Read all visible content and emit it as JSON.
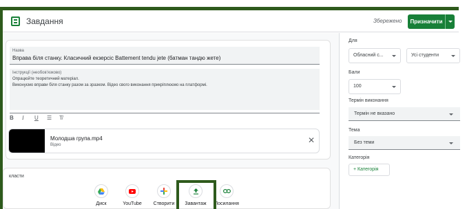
{
  "header": {
    "title": "Завдання",
    "saved": "Збережено",
    "assign_label": "Призначити"
  },
  "title_field": {
    "label": "Назва",
    "value": "Вправа біля станку. Класичний екзерсіс Battement tendu jete (батман тандю жете)"
  },
  "description_field": {
    "label": "Інструкції (необов'язково)",
    "lines": [
      "Опрацюйте теоретичний матеріал.",
      "Виконуємо вправи біля станку разом за зразком. Відео свого виконання прикріплюємо на платформі."
    ]
  },
  "format": {
    "bold": "B",
    "italic": "I",
    "underline": "U",
    "list": "☰",
    "clear": "T̸"
  },
  "attachment": {
    "name": "Молодша група.mp4",
    "type": "Відео"
  },
  "attach_section": {
    "title": "класти",
    "tools": [
      {
        "label": "Диск",
        "icon": "drive-icon"
      },
      {
        "label": "YouTube",
        "icon": "youtube-icon"
      },
      {
        "label": "Створити",
        "icon": "plus-icon"
      },
      {
        "label": "Завантаж",
        "icon": "upload-icon"
      },
      {
        "label": "Посилання",
        "icon": "link-icon"
      }
    ]
  },
  "sidebar": {
    "for_label": "Для",
    "class_value": "Обласний с...",
    "students_value": "Усі студенти",
    "points_label": "Бали",
    "points_value": "100",
    "due_label": "Термін виконання",
    "due_value": "Термін не вказано",
    "topic_label": "Тема",
    "topic_value": "Без теми",
    "category_label": "Категорія",
    "category_button": "Категорія"
  },
  "colors": {
    "accent": "#188038",
    "frame": "#2e5a1c"
  }
}
